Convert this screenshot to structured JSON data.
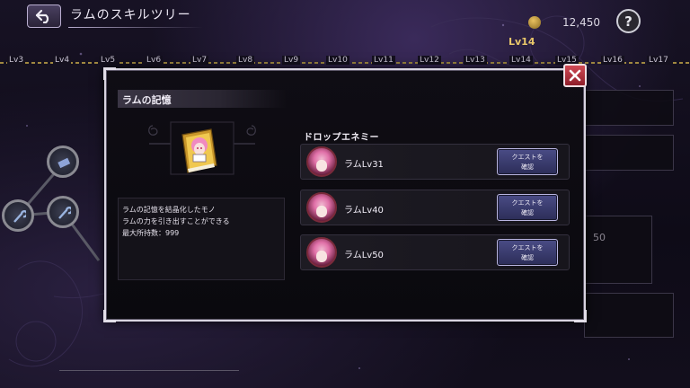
{
  "header": {
    "title": "ラムのスキルツリー",
    "coin_value": "12,450",
    "help_label": "?"
  },
  "level_ruler": {
    "levels": [
      "Lv3",
      "Lv4",
      "Lv5",
      "Lv6",
      "Lv7",
      "Lv8",
      "Lv9",
      "Lv10",
      "Lv11",
      "Lv12",
      "Lv13",
      "Lv14",
      "Lv15",
      "Lv16",
      "Lv17"
    ],
    "current_level": "Lv14"
  },
  "background_panel": {
    "value": "50"
  },
  "modal": {
    "item_name": "ラムの記憶",
    "description": [
      "ラムの記憶を結晶化したモノ",
      "ラムの力を引き出すことができる",
      "最大所持数：999"
    ],
    "drop_title": "ドロップエネミー",
    "enemies": [
      {
        "name": "ラムLv31",
        "button": [
          "クエストを",
          "確認"
        ]
      },
      {
        "name": "ラムLv40",
        "button": [
          "クエストを",
          "確認"
        ]
      },
      {
        "name": "ラムLv50",
        "button": [
          "クエストを",
          "確認"
        ]
      }
    ]
  },
  "colors": {
    "modal_border": "#d8d4e0",
    "close_button": "#c0303e",
    "quest_button": "#3a3c70",
    "level_accent": "#e9c76a"
  },
  "icons": {
    "back": "back-arrow-icon",
    "coin": "coin-icon",
    "help": "question-icon",
    "close": "close-icon",
    "item": "book-icon"
  }
}
